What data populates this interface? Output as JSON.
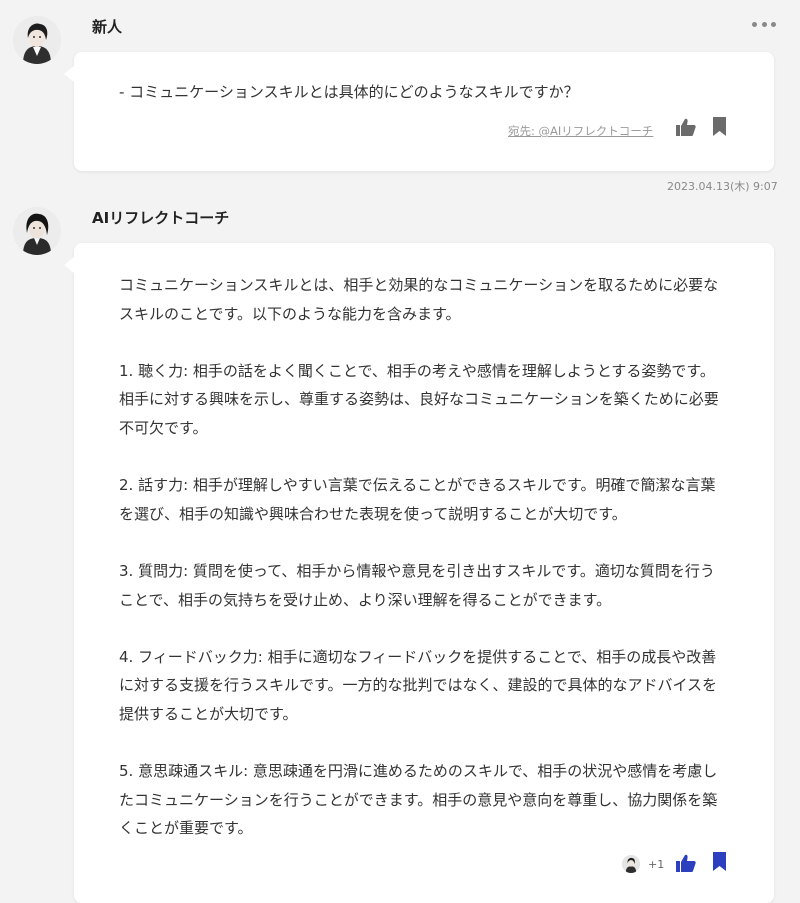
{
  "messages": [
    {
      "sender": "新人",
      "text": "- コミュニケーションスキルとは具体的にどのようなスキルですか？",
      "to_label": "宛先: @AIリフレクトコーチ",
      "timestamp": "2023.04.13(木) 9:07"
    },
    {
      "sender": "AIリフレクトコーチ",
      "text": "コミュニケーションスキルとは、相手と効果的なコミュニケーションを取るために必要な\nスキルのことです。以下のような能力を含みます。\n\n1. 聴く力: 相手の話をよく聞くことで、相手の考えや感情を理解しようとする姿勢です。\n相手に対する興味を示し、尊重する姿勢は、良好なコミュニケーションを築くために必要\n不可欠です。\n\n2. 話す力: 相手が理解しやすい言葉で伝えることができるスキルです。明確で簡潔な言葉\nを選び、相手の知識や興味合わせた表現を使って説明することが大切です。\n\n3. 質問力: 質問を使って、相手から情報や意見を引き出すスキルです。適切な質問を行う\nことで、相手の気持ちを受け止め、より深い理解を得ることができます。\n\n4. フィードバック力: 相手に適切なフィードバックを提供することで、相手の成長や改善\nに対する支援を行うスキルです。一方的な批判ではなく、建設的で具体的なアドバイスを\n提供することが大切です。\n\n5. 意思疎通スキル: 意思疎通を円滑に進めるためのスキルで、相手の状況や感情を考慮し\nたコミュニケーションを行うことができます。相手の意見や意向を尊重し、協力関係を築\nくことが重要です。",
      "reaction_count": "+1"
    }
  ],
  "colors": {
    "background": "#f3f3f3",
    "bubble": "#ffffff",
    "icon_inactive": "#6b6b6b",
    "icon_active": "#2b3fbf"
  },
  "icons": [
    "more-icon",
    "thumbs-up-icon",
    "bookmark-icon"
  ]
}
